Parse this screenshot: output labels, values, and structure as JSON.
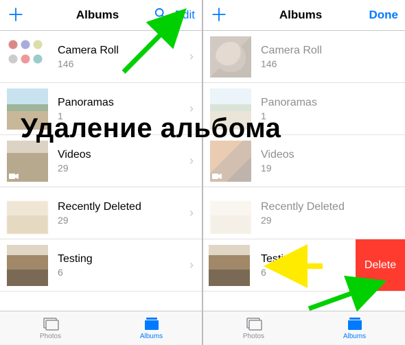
{
  "overlay_text": "Удаление альбома",
  "left": {
    "nav": {
      "title": "Albums",
      "edit": "Edit"
    },
    "albums": [
      {
        "name": "Camera Roll",
        "count": "146",
        "thumb": "t-cam",
        "video": false
      },
      {
        "name": "Panoramas",
        "count": "1",
        "thumb": "t-pano",
        "video": false
      },
      {
        "name": "Videos",
        "count": "29",
        "thumb": "t-vid",
        "video": true
      },
      {
        "name": "Recently Deleted",
        "count": "29",
        "thumb": "t-del",
        "video": false
      },
      {
        "name": "Testing",
        "count": "6",
        "thumb": "t-test",
        "video": false
      }
    ],
    "tabs": {
      "photos": "Photos",
      "albums": "Albums"
    }
  },
  "right": {
    "nav": {
      "title": "Albums",
      "done": "Done"
    },
    "albums": [
      {
        "name": "Camera Roll",
        "count": "146",
        "thumb": "t-cam-r",
        "video": false,
        "dim": true
      },
      {
        "name": "Panoramas",
        "count": "1",
        "thumb": "t-pano",
        "video": false,
        "dim": true
      },
      {
        "name": "Videos",
        "count": "19",
        "thumb": "t-vid-r",
        "video": true,
        "dim": true
      },
      {
        "name": "Recently Deleted",
        "count": "29",
        "thumb": "t-del",
        "video": false,
        "dim": true
      },
      {
        "name": "Testing",
        "count": "6",
        "thumb": "t-test",
        "video": false,
        "dim": false
      }
    ],
    "delete_label": "Delete",
    "tabs": {
      "photos": "Photos",
      "albums": "Albums"
    }
  }
}
